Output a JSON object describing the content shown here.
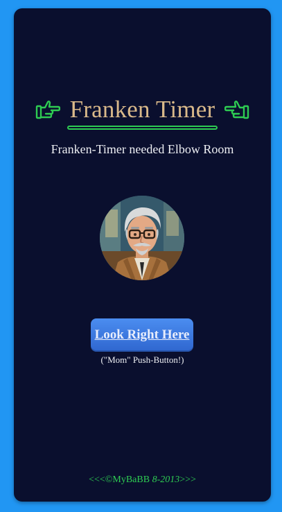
{
  "header": {
    "title": "Franken Timer",
    "left_icon": "pointing-right-hand-icon",
    "right_icon": "pointing-left-hand-icon"
  },
  "subtitle": "Franken-Timer needed Elbow Room",
  "avatar": {
    "icon": "portrait-illustration"
  },
  "main_button": {
    "label": "Look Right Here",
    "caption": "(\"Mom\" Push-Button!)"
  },
  "footer": {
    "prefix": "<<<©MyBaBB ",
    "year": "8-2013",
    "suffix": ">>>"
  },
  "colors": {
    "page_bg": "#2196f3",
    "card_bg": "#0a0f2e",
    "title": "#d9b98a",
    "accent_green": "#2ecc52",
    "button": "#3a7ae0"
  }
}
